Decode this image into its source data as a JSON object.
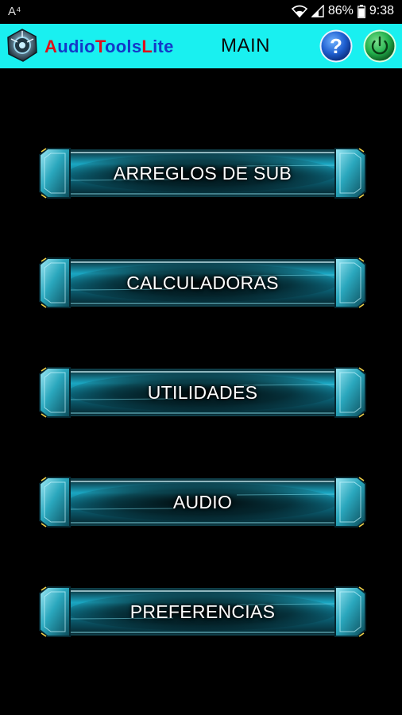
{
  "status_bar": {
    "left_indicator": "A⁴",
    "battery": "86%",
    "time": "9:38"
  },
  "app_bar": {
    "title_parts": [
      {
        "cap": "A",
        "rest": "udio"
      },
      {
        "cap": "T",
        "rest": "ools"
      },
      {
        "cap": "L",
        "rest": "ite"
      }
    ],
    "screen_title": "MAIN",
    "help_label": "?",
    "colors": {
      "bar_background": "#19f0f0",
      "title_capitals": "#e0101a",
      "title_rest": "#1438c8",
      "help_button": "#1f5fd0",
      "power_button": "#22b14c"
    }
  },
  "menu": {
    "items": [
      {
        "label": "ARREGLOS DE SUB"
      },
      {
        "label": "CALCULADORAS"
      },
      {
        "label": "UTILIDADES"
      },
      {
        "label": "AUDIO"
      },
      {
        "label": "PREFERENCIAS"
      }
    ]
  }
}
